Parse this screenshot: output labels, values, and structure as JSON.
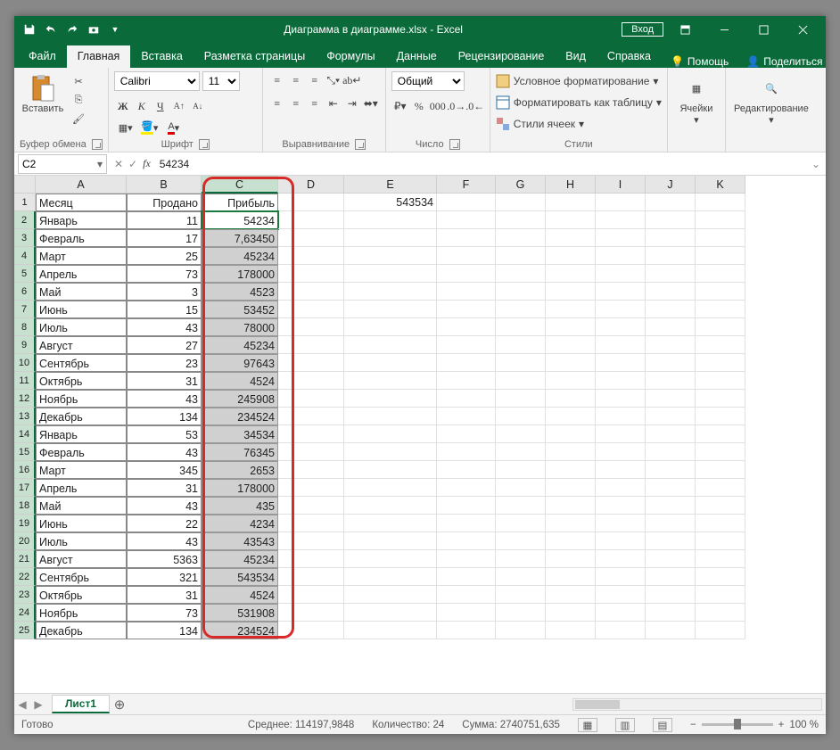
{
  "titlebar": {
    "title": "Диаграмма в диаграмме.xlsx  -  Excel",
    "login": "Вход"
  },
  "tabs": {
    "file": "Файл",
    "home": "Главная",
    "insert": "Вставка",
    "layout": "Разметка страницы",
    "formulas": "Формулы",
    "data": "Данные",
    "review": "Рецензирование",
    "view": "Вид",
    "help": "Справка",
    "assist": "Помощь",
    "share": "Поделиться"
  },
  "ribbon": {
    "clipboard": {
      "paste": "Вставить",
      "label": "Буфер обмена"
    },
    "font": {
      "name": "Calibri",
      "size": "11",
      "label": "Шрифт"
    },
    "align": {
      "label": "Выравнивание"
    },
    "number": {
      "format": "Общий",
      "label": "Число"
    },
    "styles": {
      "cond": "Условное форматирование",
      "table": "Форматировать как таблицу",
      "cell": "Стили ячеек",
      "label": "Стили"
    },
    "cells": {
      "label": "Ячейки"
    },
    "edit": {
      "label": "Редактирование"
    }
  },
  "namebox": "C2",
  "formula": "54234",
  "colheads": [
    "A",
    "B",
    "C",
    "D",
    "E",
    "F",
    "G",
    "H",
    "I",
    "J",
    "K"
  ],
  "rows": [
    {
      "n": 1,
      "a": "Месяц",
      "b": "Продано",
      "c": "Прибыль",
      "e": "543534"
    },
    {
      "n": 2,
      "a": "Январь",
      "b": "11",
      "c": "54234"
    },
    {
      "n": 3,
      "a": "Февраль",
      "b": "17",
      "c": "7,63450"
    },
    {
      "n": 4,
      "a": "Март",
      "b": "25",
      "c": "45234"
    },
    {
      "n": 5,
      "a": "Апрель",
      "b": "73",
      "c": "178000"
    },
    {
      "n": 6,
      "a": "Май",
      "b": "3",
      "c": "4523"
    },
    {
      "n": 7,
      "a": "Июнь",
      "b": "15",
      "c": "53452"
    },
    {
      "n": 8,
      "a": "Июль",
      "b": "43",
      "c": "78000"
    },
    {
      "n": 9,
      "a": "Август",
      "b": "27",
      "c": "45234"
    },
    {
      "n": 10,
      "a": "Сентябрь",
      "b": "23",
      "c": "97643"
    },
    {
      "n": 11,
      "a": "Октябрь",
      "b": "31",
      "c": "4524"
    },
    {
      "n": 12,
      "a": "Ноябрь",
      "b": "43",
      "c": "245908"
    },
    {
      "n": 13,
      "a": "Декабрь",
      "b": "134",
      "c": "234524"
    },
    {
      "n": 14,
      "a": "Январь",
      "b": "53",
      "c": "34534"
    },
    {
      "n": 15,
      "a": "Февраль",
      "b": "43",
      "c": "76345"
    },
    {
      "n": 16,
      "a": "Март",
      "b": "345",
      "c": "2653"
    },
    {
      "n": 17,
      "a": "Апрель",
      "b": "31",
      "c": "178000"
    },
    {
      "n": 18,
      "a": "Май",
      "b": "43",
      "c": "435"
    },
    {
      "n": 19,
      "a": "Июнь",
      "b": "22",
      "c": "4234"
    },
    {
      "n": 20,
      "a": "Июль",
      "b": "43",
      "c": "43543"
    },
    {
      "n": 21,
      "a": "Август",
      "b": "5363",
      "c": "45234"
    },
    {
      "n": 22,
      "a": "Сентябрь",
      "b": "321",
      "c": "543534"
    },
    {
      "n": 23,
      "a": "Октябрь",
      "b": "31",
      "c": "4524"
    },
    {
      "n": 24,
      "a": "Ноябрь",
      "b": "73",
      "c": "531908"
    },
    {
      "n": 25,
      "a": "Декабрь",
      "b": "134",
      "c": "234524"
    }
  ],
  "sheetTab": "Лист1",
  "status": {
    "ready": "Готово",
    "avg": "Среднее: 114197,9848",
    "count": "Количество: 24",
    "sum": "Сумма: 2740751,635",
    "zoom": "100 %"
  }
}
